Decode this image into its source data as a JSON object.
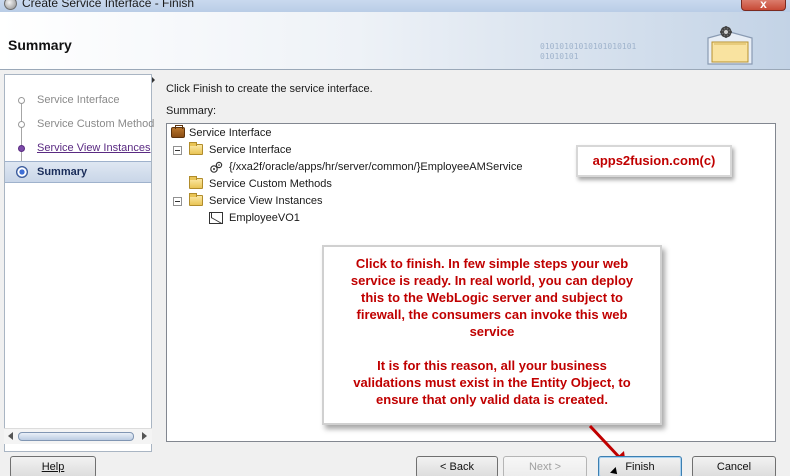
{
  "window": {
    "title": "Create Service Interface - Finish",
    "close_glyph": "x"
  },
  "header": {
    "title": "Summary",
    "binary_art": "01010101010101010101\n01010101"
  },
  "nav": {
    "items": [
      {
        "label": "Service Interface",
        "state": "done"
      },
      {
        "label": "Service Custom Method",
        "state": "done"
      },
      {
        "label": "Service View Instances",
        "state": "link"
      },
      {
        "label": "Summary",
        "state": "active"
      }
    ]
  },
  "content": {
    "instruction": "Click Finish to create the service interface.",
    "summary_label": "Summary:",
    "tree": {
      "root": "Service Interface",
      "service_interface": "Service Interface",
      "service_name": "{/xxa2f/oracle/apps/hr/server/common/}EmployeeAMService",
      "custom_methods": "Service Custom Methods",
      "view_instances": "Service View Instances",
      "view_object": "EmployeeVO1"
    }
  },
  "annotations": {
    "watermark": "apps2fusion.com(c)",
    "callout_lines": [
      "Click to finish. In few simple steps your web",
      "service is ready. In real world, you can deploy",
      "this to the WebLogic server and subject to",
      "firewall, the consumers can invoke this web",
      "service"
    ],
    "callout_lines_2": [
      "It is for this reason, all your business",
      "validations must exist in the Entity Object, to",
      "ensure that only valid data is created."
    ],
    "accent_color": "#c00000"
  },
  "buttons": {
    "help": "Help",
    "back": "< Back",
    "next": "Next >",
    "finish": "Finish",
    "cancel": "Cancel"
  }
}
